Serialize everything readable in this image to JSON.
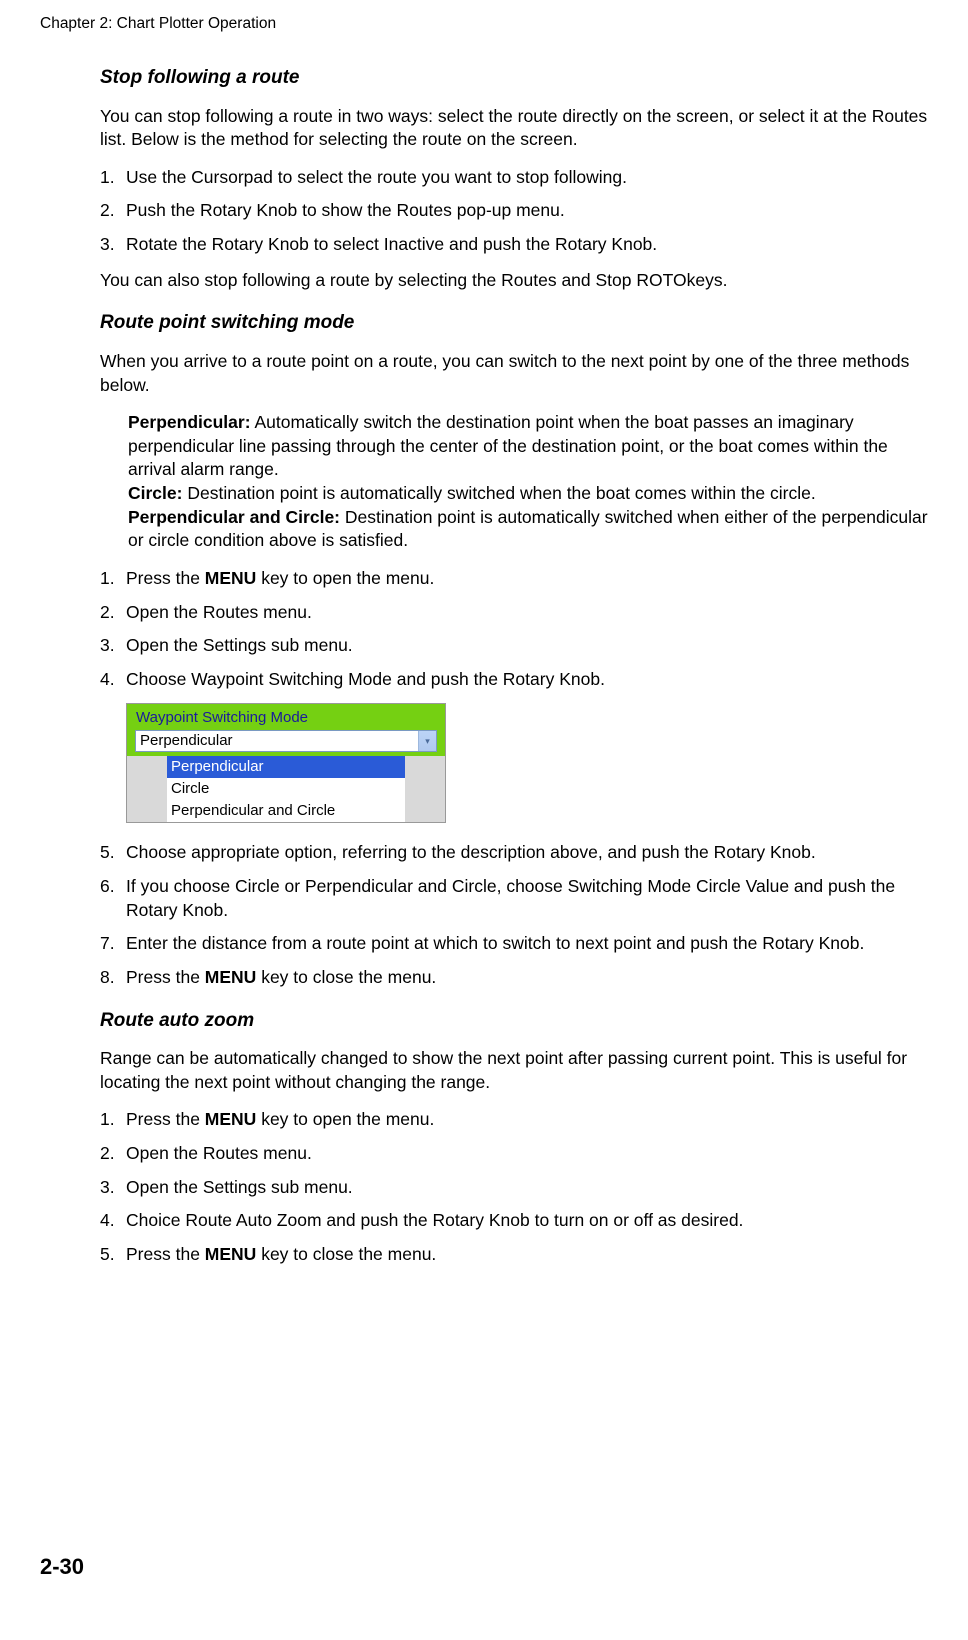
{
  "chapter_header": "Chapter 2: Chart Plotter Operation",
  "page_number": "2-30",
  "sec1": {
    "title": "Stop following a route",
    "intro": "You can stop following a route in two ways: select the route directly on the screen, or select it at the Routes list. Below is the method for selecting the route on the screen.",
    "steps": {
      "s1": "Use the Cursorpad to select the route you want to stop following.",
      "s2": "Push the Rotary Knob to show the Routes pop-up menu.",
      "s3": "Rotate the Rotary Knob to select Inactive and push the Rotary Knob."
    },
    "after": "You can also stop following a route by selecting the Routes and Stop ROTOkeys."
  },
  "sec2": {
    "title": "Route point switching mode",
    "intro": "When you arrive to a route point on a route, you can switch to the next point by one of the three methods below.",
    "modes": {
      "perp_lbl": "Perpendicular:",
      "perp_txt": " Automatically switch the destination point when the boat passes an imaginary perpendicular line passing through the center of the destination point, or the boat comes within the arrival alarm range.",
      "circ_lbl": "Circle:",
      "circ_txt": " Destination point is automatically switched when the boat comes within the circle.",
      "pc_lbl": "Perpendicular and Circle:",
      "pc_txt": " Destination point is automatically switched when either of the perpendicular or circle condition above is satisfied."
    },
    "stepsA": {
      "s1a": "Press the ",
      "s1b": "MENU",
      "s1c": " key to open the menu.",
      "s2": "Open the Routes menu.",
      "s3": "Open the Settings sub menu.",
      "s4": "Choose Waypoint Switching Mode and push the Rotary Knob."
    },
    "figure": {
      "label": "Waypoint Switching Mode",
      "selected": "Perpendicular",
      "opt1": "Perpendicular",
      "opt2": "Circle",
      "opt3": "Perpendicular and Circle"
    },
    "stepsB": {
      "s5": "Choose appropriate option, referring to the description above, and push the Rotary Knob.",
      "s6": "If you choose Circle or Perpendicular and Circle, choose Switching Mode Circle Value and push the Rotary Knob.",
      "s7": "Enter the distance from a route point at which to switch to next point and push the Rotary Knob.",
      "s8a": "Press the ",
      "s8b": "MENU",
      "s8c": " key to close the menu."
    }
  },
  "sec3": {
    "title": "Route auto zoom",
    "intro": "Range can be automatically changed to show the next point after passing current point. This is useful for locating the next point without changing the range.",
    "steps": {
      "s1a": "Press the ",
      "s1b": "MENU",
      "s1c": " key to open the menu.",
      "s2": "Open the Routes menu.",
      "s3": "Open the Settings sub menu.",
      "s4": "Choice Route Auto Zoom and push the Rotary Knob to turn on or off as desired.",
      "s5a": "Press the ",
      "s5b": "MENU",
      "s5c": " key to close the menu."
    }
  }
}
